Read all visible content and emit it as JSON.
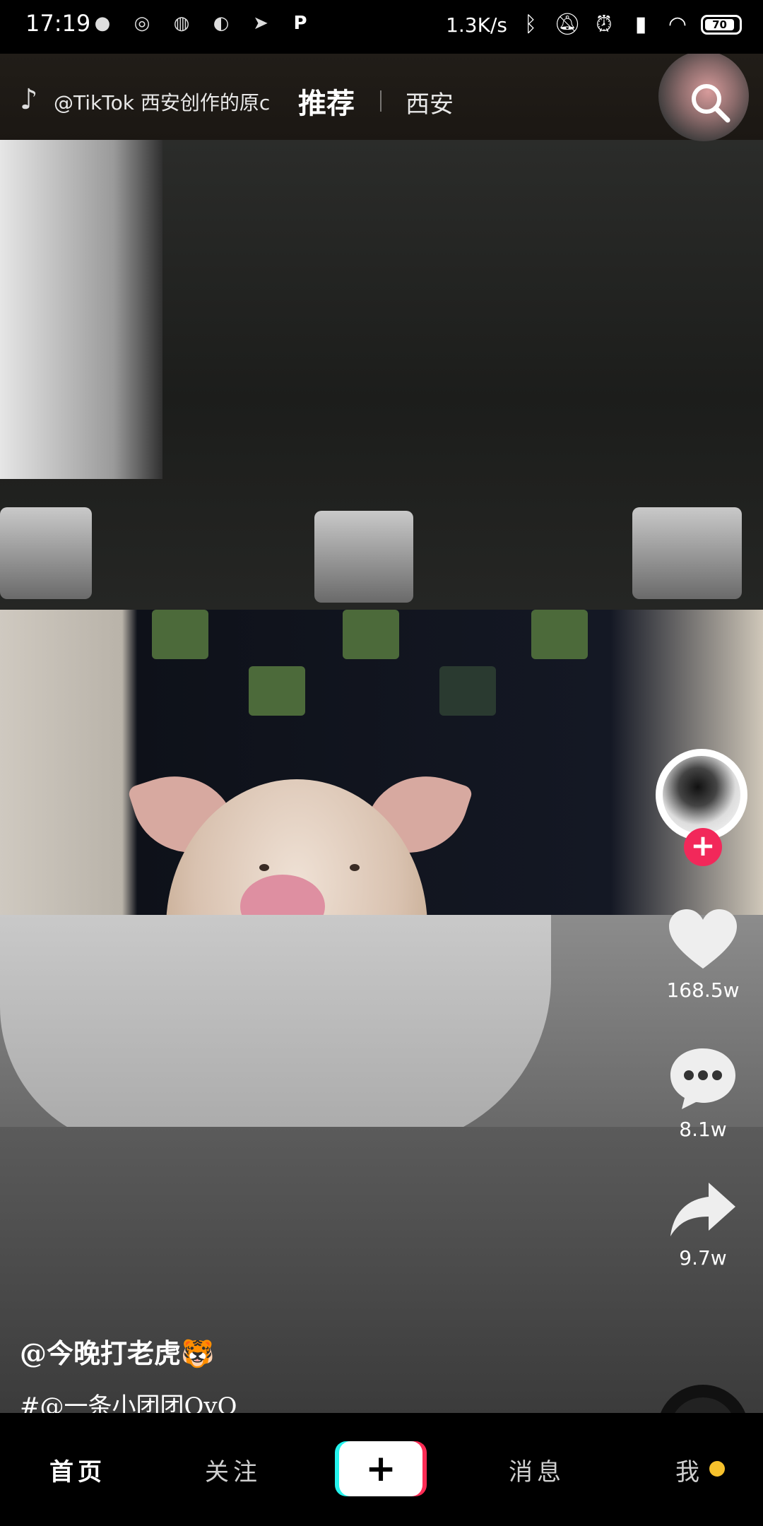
{
  "status_bar": {
    "time": "17:19",
    "net_speed": "1.3K/s",
    "battery": "70",
    "left_icons": [
      "wechat-icon",
      "browser-icon",
      "globe-icon",
      "vpn-icon",
      "location-icon",
      "p-app-icon"
    ],
    "right_icons": [
      "bluetooth-icon",
      "mute-icon",
      "alarm-icon",
      "signal-icon",
      "wifi-icon",
      "battery-icon"
    ]
  },
  "top_bar": {
    "source_text": "@TikTok 西安创作的原c",
    "tab_recommend": "推荐",
    "tab_city": "西安"
  },
  "actions": {
    "likes": "168.5w",
    "comments": "8.1w",
    "shares": "9.7w",
    "follow_symbol": "+"
  },
  "caption": {
    "author": "@今晚打老虎🐯",
    "tag": "#@一条小团团OvO"
  },
  "bottom_nav": {
    "home": "首页",
    "follow": "关注",
    "create": "+",
    "messages": "消息",
    "me": "我"
  },
  "colors": {
    "follow_badge": "#f2285a",
    "create_left_shadow": "#25f4ee",
    "create_right_shadow": "#fe2c55",
    "notification_dot": "#f6c12c"
  }
}
